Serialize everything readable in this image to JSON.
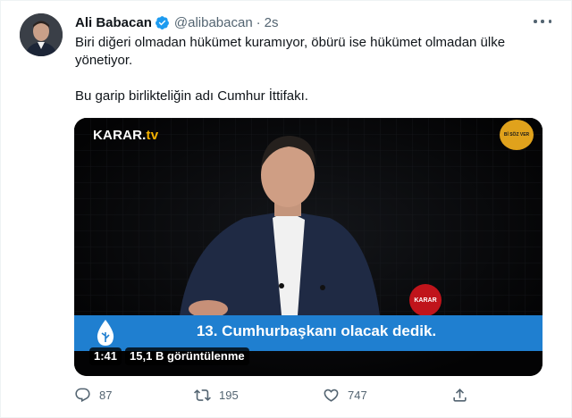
{
  "tweet": {
    "author_name": "Ali Babacan",
    "author_handle": "@alibabacan",
    "separator": "·",
    "timestamp": "2s",
    "text_line1": "Biri diğeri olmadan hükümet kuramıyor, öbürü ise hükümet olmadan ülke",
    "text_line2": "yönetiyor.",
    "text_line3": "Bu garip birlikteliğin adı Cumhur İttifakı."
  },
  "video": {
    "channel_logo_main": "KARAR.",
    "channel_logo_tv": "tv",
    "corner_badge": "Bİ SÖZ VER",
    "caption": "13. Cumhurbaşkanı olacak dedik.",
    "duration": "1:41",
    "views": "15,1 B görüntülenme",
    "mic_label": "KARAR"
  },
  "actions": {
    "replies": "87",
    "retweets": "195",
    "likes": "747"
  },
  "colors": {
    "verified": "#1d9bf0",
    "secondary_text": "#536471",
    "caption_bar": "#1f7fd0",
    "accent_tv": "#f5b200"
  },
  "icons": [
    "verified-badge-icon",
    "more-icon",
    "reply-icon",
    "retweet-icon",
    "like-icon",
    "share-icon",
    "water-drop-icon"
  ]
}
